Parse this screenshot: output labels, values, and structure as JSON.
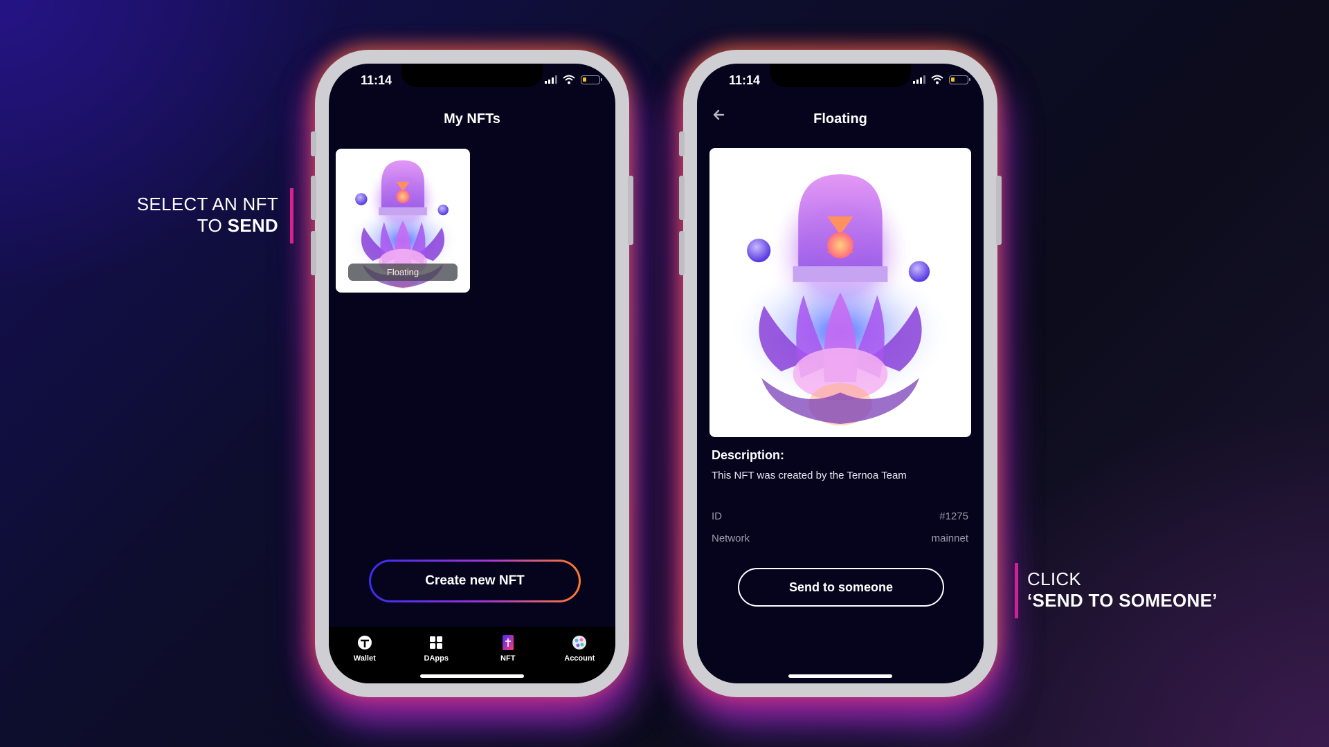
{
  "captions": {
    "left": {
      "line1": "SELECT AN NFT",
      "line2_prefix": "TO ",
      "line2_bold": "SEND"
    },
    "right": {
      "line1": "CLICK",
      "line2": "‘SEND TO SOMEONE’"
    },
    "accent_color": "#e0238d"
  },
  "status_bar": {
    "time": "11:14"
  },
  "my_nfts_screen": {
    "title": "My NFTs",
    "nft_card": {
      "label": "Floating"
    },
    "create_button": "Create new NFT",
    "tabs": [
      {
        "label": "Wallet",
        "icon": "wallet-icon"
      },
      {
        "label": "DApps",
        "icon": "dapps-grid-icon"
      },
      {
        "label": "NFT",
        "icon": "nft-icon"
      },
      {
        "label": "Account",
        "icon": "account-icon"
      }
    ]
  },
  "nft_detail_screen": {
    "title": "Floating",
    "description_heading": "Description:",
    "description": "This NFT was created by the Ternoa Team",
    "meta": [
      {
        "key": "ID",
        "value": "#1275"
      },
      {
        "key": "Network",
        "value": "mainnet"
      }
    ],
    "send_button": "Send to someone"
  }
}
